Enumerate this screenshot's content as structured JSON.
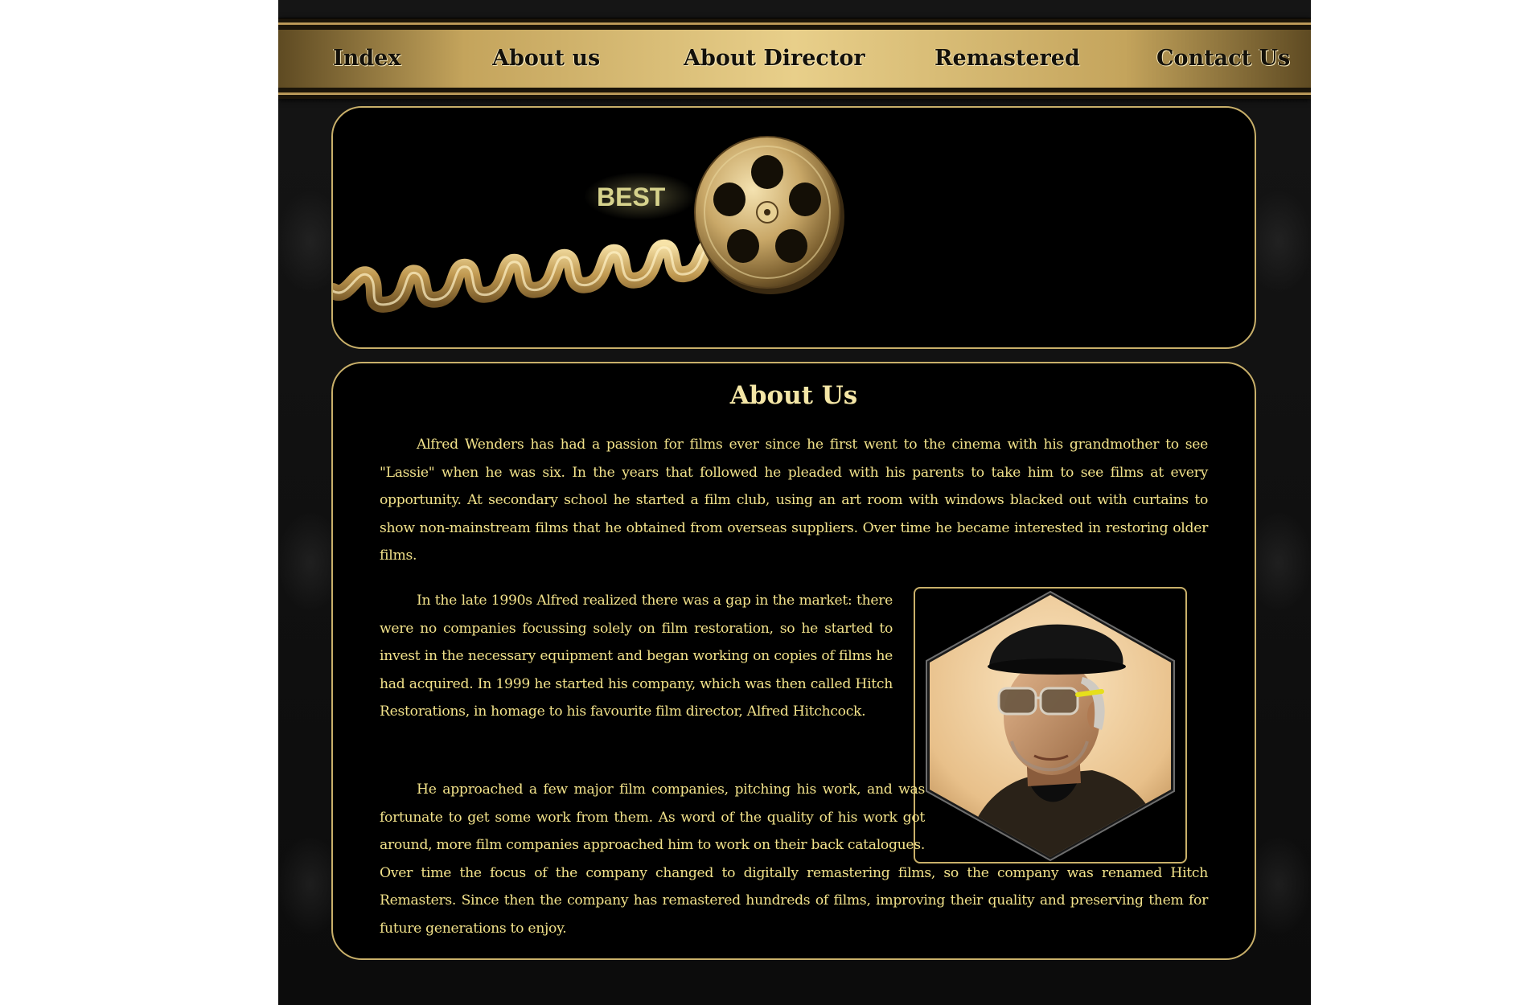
{
  "nav": {
    "items": [
      {
        "label": "Index"
      },
      {
        "label": "About us"
      },
      {
        "label": "About Director"
      },
      {
        "label": "Remastered"
      },
      {
        "label": "Contact Us"
      }
    ]
  },
  "banner": {
    "best_text": "BEST"
  },
  "content": {
    "title": "About Us",
    "paragraph1": "Alfred Wenders has had a passion for films ever since he first went to the cinema with his grandmother to see \"Lassie\" when he was six. In the years that followed he pleaded with his parents to take him to see films at every opportunity. At secondary school he started a film club, using an art room with windows blacked out with curtains to show non-mainstream films that he obtained from overseas suppliers. Over time he became interested in restoring older films.",
    "paragraph2": "In the late 1990s Alfred realized there was a gap in the market: there were no companies focussing solely on film restoration, so he started to invest in the necessary equipment and began working on copies of films he had acquired. In 1999 he started his company, which was then called Hitch Restorations, in homage to his favourite film director, Alfred Hitchcock.",
    "paragraph3": "He approached a few major film companies, pitching his work, and was fortunate to get some work from them. As word of the quality of his work got around, more film companies approached him to work on their back catalogues. Over time the focus of the company changed to digitally remastering films, so the company was renamed Hitch Remasters. Since then the company has remastered hundreds of films, improving their quality and preserving them for future generations to enjoy."
  },
  "colors": {
    "gold": "#c9b06a",
    "text": "#f2e28a",
    "title": "#f4e6a6",
    "background": "#0c0c0c"
  },
  "icons": {
    "banner": "film-reel-icon",
    "photo": "director-portrait-image"
  }
}
